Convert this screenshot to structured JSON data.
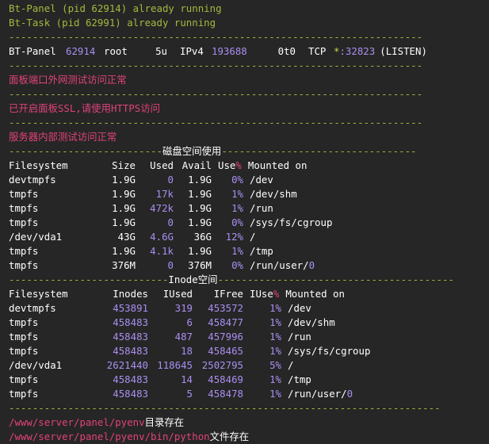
{
  "status": {
    "panel": "Bt-Panel (pid 62914) already running",
    "task": "Bt-Task (pid 62991) already running"
  },
  "separator": "----------------------------------------------------------------------",
  "lsof": {
    "cmd": "BT-Panel",
    "pid": "62914",
    "user": "root",
    "fd": "5u",
    "type": "IPv4",
    "device": "193688",
    "size": "0t0",
    "node": "TCP",
    "star": "*",
    "port": ":32823",
    "state": "(LISTEN)"
  },
  "messages": {
    "external": "面板端口外网测试访问正常",
    "ssl": "已开启面板SSL,请使用HTTPS访问",
    "internal": "服务器内部测试访问正常"
  },
  "disk": {
    "title_left": "--------------------------",
    "title": "磁盘空间使用",
    "title_right": "---------------------------------",
    "header": {
      "fs": "Filesystem",
      "size": "Size",
      "used": "Used",
      "avail": "Avail",
      "use": "Use",
      "pct": "%",
      "mounted": "Mounted on"
    },
    "rows": [
      {
        "fs": "devtmpfs",
        "size": "1.9G",
        "used": "0",
        "avail": "1.9G",
        "use": "0%",
        "mount": "/dev"
      },
      {
        "fs": "tmpfs",
        "size": "1.9G",
        "used": "17k",
        "avail": "1.9G",
        "use": "1%",
        "mount": "/dev/shm"
      },
      {
        "fs": "tmpfs",
        "size": "1.9G",
        "used": "472k",
        "avail": "1.9G",
        "use": "1%",
        "mount": "/run"
      },
      {
        "fs": "tmpfs",
        "size": "1.9G",
        "used": "0",
        "avail": "1.9G",
        "use": "0%",
        "mount": "/sys/fs/cgroup"
      },
      {
        "fs": "/dev/vda1",
        "size": "43G",
        "used": "4.6G",
        "avail": "36G",
        "use": "12%",
        "mount": "/"
      },
      {
        "fs": "tmpfs",
        "size": "1.9G",
        "used": "4.1k",
        "avail": "1.9G",
        "use": "1%",
        "mount": "/tmp"
      },
      {
        "fs": "tmpfs",
        "size": "376M",
        "used": "0",
        "avail": "376M",
        "use": "0%",
        "mount": "/run/user/",
        "mount_hl": "0"
      }
    ]
  },
  "inode": {
    "title_left": "---------------------------",
    "title": "Inode空间",
    "title_right": "----------------------------------------",
    "header": {
      "fs": "Filesystem",
      "inodes": "Inodes",
      "iused": "IUsed",
      "ifree": "IFree",
      "iuse": "IUse",
      "pct": "%",
      "mounted": "Mounted on"
    },
    "rows": [
      {
        "fs": "devtmpfs",
        "inodes": "453891",
        "iused": "319",
        "ifree": "453572",
        "iuse": "1%",
        "mount": "/dev"
      },
      {
        "fs": "tmpfs",
        "inodes": "458483",
        "iused": "6",
        "ifree": "458477",
        "iuse": "1%",
        "mount": "/dev/shm"
      },
      {
        "fs": "tmpfs",
        "inodes": "458483",
        "iused": "487",
        "ifree": "457996",
        "iuse": "1%",
        "mount": "/run"
      },
      {
        "fs": "tmpfs",
        "inodes": "458483",
        "iused": "18",
        "ifree": "458465",
        "iuse": "1%",
        "mount": "/sys/fs/cgroup"
      },
      {
        "fs": "/dev/vda1",
        "inodes": "2621440",
        "iused": "118645",
        "ifree": "2502795",
        "iuse": "5%",
        "mount": "/"
      },
      {
        "fs": "tmpfs",
        "inodes": "458483",
        "iused": "14",
        "ifree": "458469",
        "iuse": "1%",
        "mount": "/tmp"
      },
      {
        "fs": "tmpfs",
        "inodes": "458483",
        "iused": "5",
        "ifree": "458478",
        "iuse": "1%",
        "mount": "/run/user/",
        "mount_hl": "0"
      }
    ]
  },
  "bottom_sep": "-------------------------------------------------------------------------",
  "paths": [
    {
      "path": "/www/server/panel/pyenv",
      "suffix": "目录存在"
    },
    {
      "path": "/www/server/panel/pyenv/bin/python",
      "suffix": "文件存在"
    }
  ]
}
